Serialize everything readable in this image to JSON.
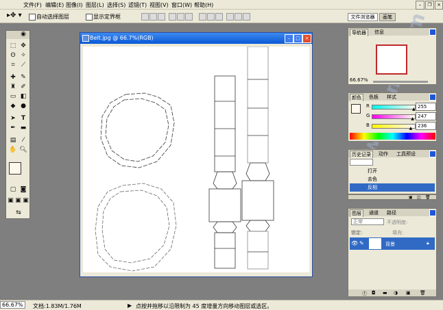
{
  "menu": [
    "文件(F)",
    "编辑(E)",
    "图像(I)",
    "图层(L)",
    "选择(S)",
    "滤镜(T)",
    "视图(V)",
    "窗口(W)",
    "帮助(H)"
  ],
  "options": {
    "auto_select_layer": "自动选择图层",
    "show_bounding_box": "显示定界框"
  },
  "palette_well": {
    "file_browser": "文件浏览器",
    "brushes": "画笔"
  },
  "document": {
    "title": "Belt.jpg @ 66.7%(RGB)"
  },
  "navigator": {
    "tabs": [
      "导航器",
      "信息"
    ],
    "zoom": "66.67%"
  },
  "color": {
    "tabs": [
      "颜色",
      "色板",
      "样式"
    ],
    "channels": [
      {
        "label": "R",
        "value": "255",
        "fraction": 1.0
      },
      {
        "label": "G",
        "value": "247",
        "fraction": 0.969
      },
      {
        "label": "B",
        "value": "236",
        "fraction": 0.925
      }
    ]
  },
  "history": {
    "tabs": [
      "历史记录",
      "动作",
      "工具预设"
    ],
    "items": [
      {
        "label": "打开",
        "selected": false
      },
      {
        "label": "去色",
        "selected": false
      },
      {
        "label": "反相",
        "selected": true
      }
    ]
  },
  "layers": {
    "tabs": [
      "图层",
      "通道",
      "路径"
    ],
    "blend_mode": "正常",
    "opacity_label": "不透明度:",
    "lock_label": "锁定:",
    "fill_label": "填充:",
    "layer_name": "背景"
  },
  "status": {
    "zoom": "66.67%",
    "doc_size": "文档:1.83M/1.76M",
    "hint": "点按并拖移以沿限制为 45 度增量方向移动图层或选区。"
  },
  "colors": {
    "titlebar": "#0a58d6",
    "panel_bg": "#ece9d8",
    "selected": "#316ac5",
    "workspace": "#7f7f7f"
  }
}
